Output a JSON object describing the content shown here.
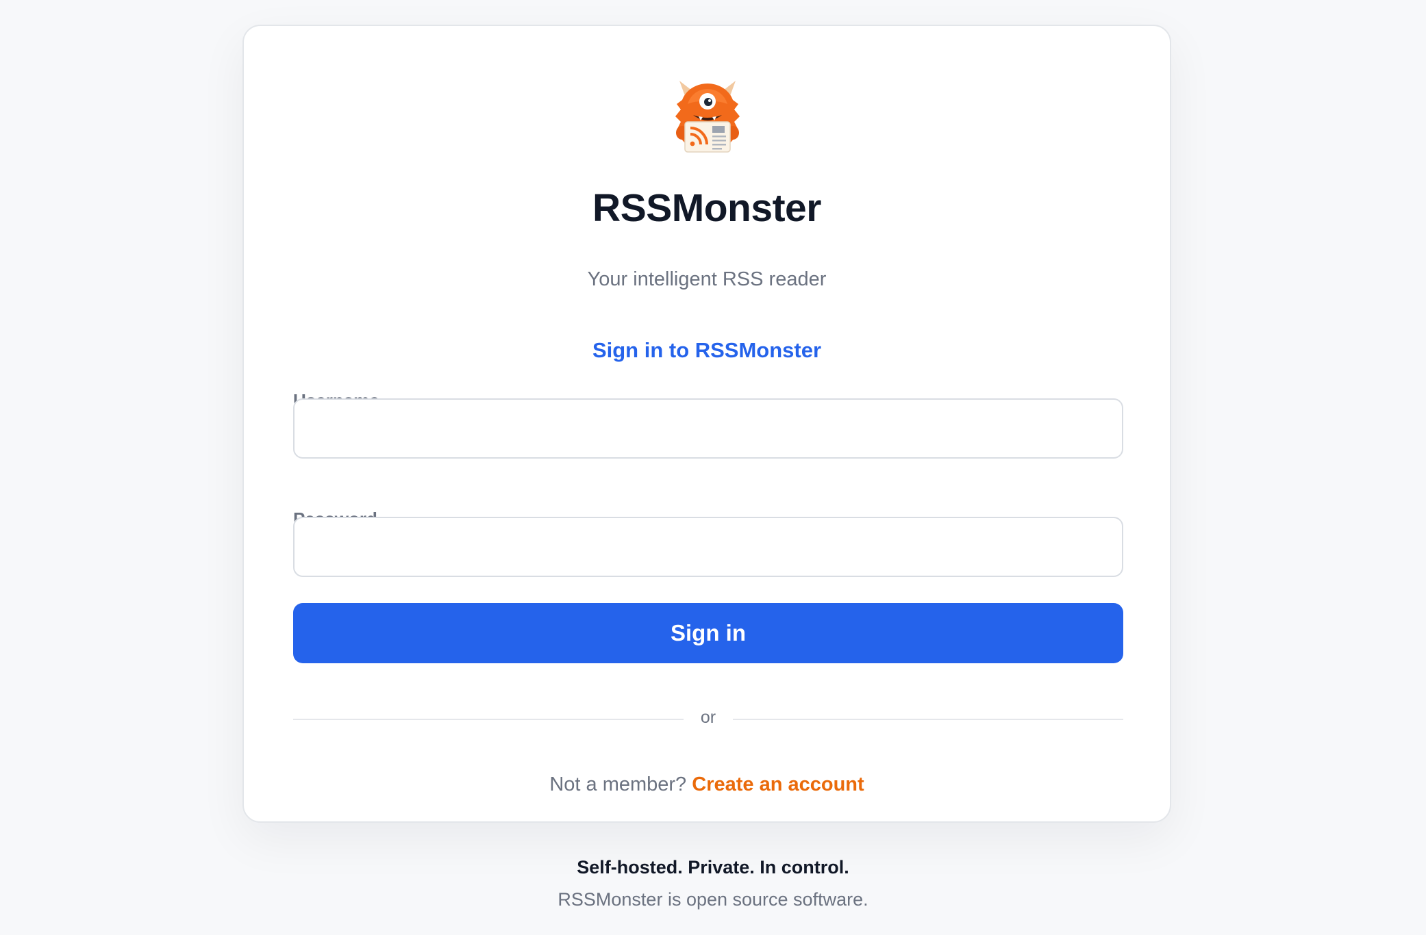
{
  "app": {
    "title": "RSSMonster",
    "subtitle": "Your intelligent RSS reader",
    "logo_icon": "monster-rss-logo-icon"
  },
  "form": {
    "heading": "Sign in to RSSMonster",
    "username_label": "Username",
    "username_value": "",
    "password_label": "Password",
    "password_value": "",
    "submit_label": "Sign in",
    "divider_text": "or"
  },
  "signup": {
    "prompt": "Not a member?",
    "link_label": "Create an account"
  },
  "footer": {
    "tagline": "Self-hosted. Private. In control.",
    "note": "RSSMonster is open source software."
  },
  "colors": {
    "primary": "#2563eb",
    "accent_orange": "#ea6a0a",
    "background": "#f7f8fa",
    "card": "#ffffff",
    "text_dark": "#111827",
    "text_muted": "#6b7280"
  }
}
